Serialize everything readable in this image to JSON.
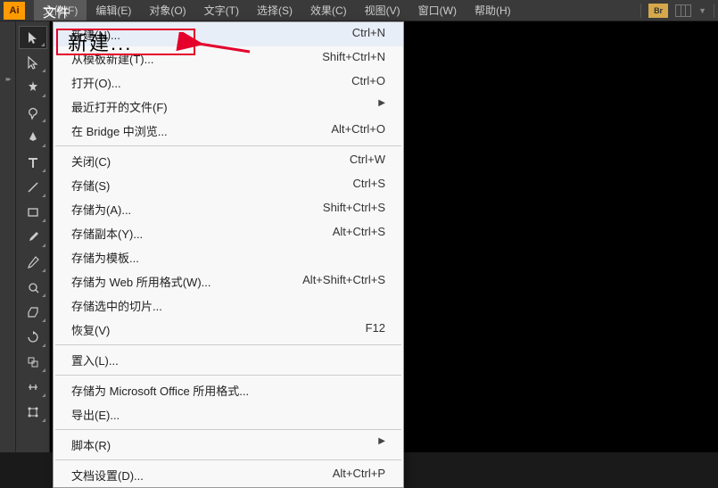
{
  "app": {
    "logo": "Ai"
  },
  "menubar": {
    "file": "文件(F)",
    "edit": "编辑(E)",
    "object": "对象(O)",
    "type": "文字(T)",
    "select": "选择(S)",
    "effect": "效果(C)",
    "view": "视图(V)",
    "window": "窗口(W)",
    "help": "帮助(H)",
    "br_badge": "Br"
  },
  "overlay_label": "文件",
  "highlight_label": "新建...",
  "dropdown": {
    "groups": [
      [
        {
          "label": "新建(N)...",
          "shortcut": "Ctrl+N"
        },
        {
          "label": "从模板新建(T)...",
          "shortcut": "Shift+Ctrl+N"
        },
        {
          "label": "打开(O)...",
          "shortcut": "Ctrl+O"
        },
        {
          "label": "最近打开的文件(F)",
          "submenu": true
        },
        {
          "label": "在 Bridge 中浏览...",
          "shortcut": "Alt+Ctrl+O"
        }
      ],
      [
        {
          "label": "关闭(C)",
          "shortcut": "Ctrl+W"
        },
        {
          "label": "存储(S)",
          "shortcut": "Ctrl+S"
        },
        {
          "label": "存储为(A)...",
          "shortcut": "Shift+Ctrl+S"
        },
        {
          "label": "存储副本(Y)...",
          "shortcut": "Alt+Ctrl+S"
        },
        {
          "label": "存储为模板..."
        },
        {
          "label": "存储为 Web 所用格式(W)...",
          "shortcut": "Alt+Shift+Ctrl+S"
        },
        {
          "label": "存储选中的切片..."
        },
        {
          "label": "恢复(V)",
          "shortcut": "F12"
        }
      ],
      [
        {
          "label": "置入(L)..."
        }
      ],
      [
        {
          "label": "存储为 Microsoft Office 所用格式..."
        },
        {
          "label": "导出(E)..."
        }
      ],
      [
        {
          "label": "脚本(R)",
          "submenu": true
        }
      ],
      [
        {
          "label": "文档设置(D)...",
          "shortcut": "Alt+Ctrl+P"
        }
      ]
    ]
  },
  "tools": [
    {
      "name": "selection-tool",
      "active": true
    },
    {
      "name": "direct-selection-tool"
    },
    {
      "name": "magic-wand-tool"
    },
    {
      "name": "lasso-tool"
    },
    {
      "name": "pen-tool"
    },
    {
      "name": "type-tool"
    },
    {
      "name": "line-tool"
    },
    {
      "name": "rectangle-tool"
    },
    {
      "name": "paintbrush-tool"
    },
    {
      "name": "pencil-tool"
    },
    {
      "name": "blob-brush-tool"
    },
    {
      "name": "eraser-tool"
    },
    {
      "name": "rotate-tool"
    },
    {
      "name": "scale-tool"
    },
    {
      "name": "width-tool"
    },
    {
      "name": "free-transform-tool"
    }
  ]
}
